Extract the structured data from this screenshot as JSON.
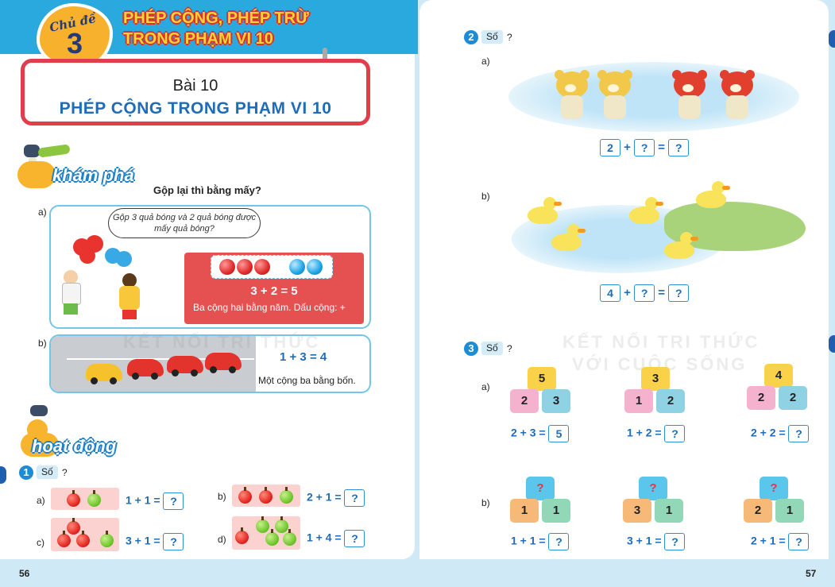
{
  "header": {
    "topic_label": "Chủ đề",
    "topic_number": "3",
    "topic_title_line1": "PHÉP CỘNG, PHÉP TRỪ",
    "topic_title_line2": "TRONG PHẠM VI 10",
    "lesson_number": "Bài 10",
    "lesson_title": "PHÉP CỘNG TRONG PHẠM VI 10"
  },
  "explore": {
    "section_label": "khám phá",
    "question": "Gộp lại thì bằng mấy?",
    "part_a": {
      "label": "a)",
      "speech": "Gộp 3 quả bóng và 2 quả bóng được mấy quả bóng?",
      "red_balls": 3,
      "blue_balls": 2,
      "equation": "3 + 2 = 5",
      "reading": "Ba cộng hai bằng năm. Dấu cộng: +"
    },
    "part_b": {
      "label": "b)",
      "equation": "1 + 3 = 4",
      "reading": "Một cộng ba bằng bốn."
    }
  },
  "activity": {
    "section_label": "hoạt động",
    "exercise1": {
      "number": "1",
      "so_label": "Số",
      "qmark": "?",
      "items": [
        {
          "label": "a)",
          "left": "1 + 1 =",
          "answer": "?"
        },
        {
          "label": "b)",
          "left": "2 + 1 =",
          "answer": "?"
        },
        {
          "label": "c)",
          "left": "3 + 1 =",
          "answer": "?"
        },
        {
          "label": "d)",
          "left": "1 + 4 =",
          "answer": "?"
        }
      ]
    }
  },
  "exercise2": {
    "number": "2",
    "so_label": "Số",
    "qmark": "?",
    "part_a": {
      "label": "a)",
      "first": "2",
      "plus": "+",
      "second": "?",
      "equals": "=",
      "result": "?"
    },
    "part_b": {
      "label": "b)",
      "first": "4",
      "plus": "+",
      "second": "?",
      "equals": "=",
      "result": "?"
    }
  },
  "exercise3": {
    "number": "3",
    "so_label": "Số",
    "qmark": "?",
    "part_a_label": "a)",
    "part_b_label": "b)",
    "row_a": [
      {
        "top": "5",
        "left": "2",
        "right": "3",
        "eq": "2 + 3 =",
        "answer": "5"
      },
      {
        "top": "3",
        "left": "1",
        "right": "2",
        "eq": "1 + 2 =",
        "answer": "?"
      },
      {
        "top": "4",
        "left": "2",
        "right": "2",
        "eq": "2 + 2 =",
        "answer": "?"
      }
    ],
    "row_b": [
      {
        "top": "?",
        "left": "1",
        "right": "1",
        "eq": "1 + 1 =",
        "answer": "?"
      },
      {
        "top": "?",
        "left": "3",
        "right": "1",
        "eq": "3 + 1 =",
        "answer": "?"
      },
      {
        "top": "?",
        "left": "2",
        "right": "1",
        "eq": "2 + 1 =",
        "answer": "?"
      }
    ]
  },
  "watermark": {
    "line1": "KẾT NỐI TRI THỨC",
    "line2": "VỚI CUỘC SỐNG"
  },
  "page_numbers": {
    "left": "56",
    "right": "57"
  }
}
